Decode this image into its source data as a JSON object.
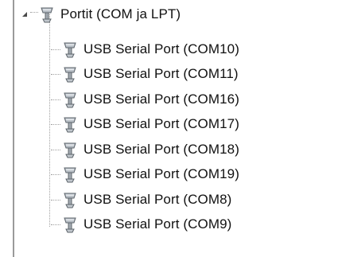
{
  "tree": {
    "root": {
      "label": "Portit (COM ja LPT)",
      "icon": "serial-port-icon",
      "expanded": true
    },
    "children": [
      {
        "label": "USB Serial Port (COM10)",
        "icon": "serial-port-icon"
      },
      {
        "label": "USB Serial Port (COM11)",
        "icon": "serial-port-icon"
      },
      {
        "label": "USB Serial Port (COM16)",
        "icon": "serial-port-icon"
      },
      {
        "label": "USB Serial Port (COM17)",
        "icon": "serial-port-icon"
      },
      {
        "label": "USB Serial Port (COM18)",
        "icon": "serial-port-icon"
      },
      {
        "label": "USB Serial Port (COM19)",
        "icon": "serial-port-icon"
      },
      {
        "label": "USB Serial Port (COM8)",
        "icon": "serial-port-icon"
      },
      {
        "label": "USB Serial Port (COM9)",
        "icon": "serial-port-icon"
      }
    ]
  },
  "colors": {
    "connector": "#a0a0a0",
    "text": "#111111",
    "icon_body": "#9fa6ad"
  }
}
